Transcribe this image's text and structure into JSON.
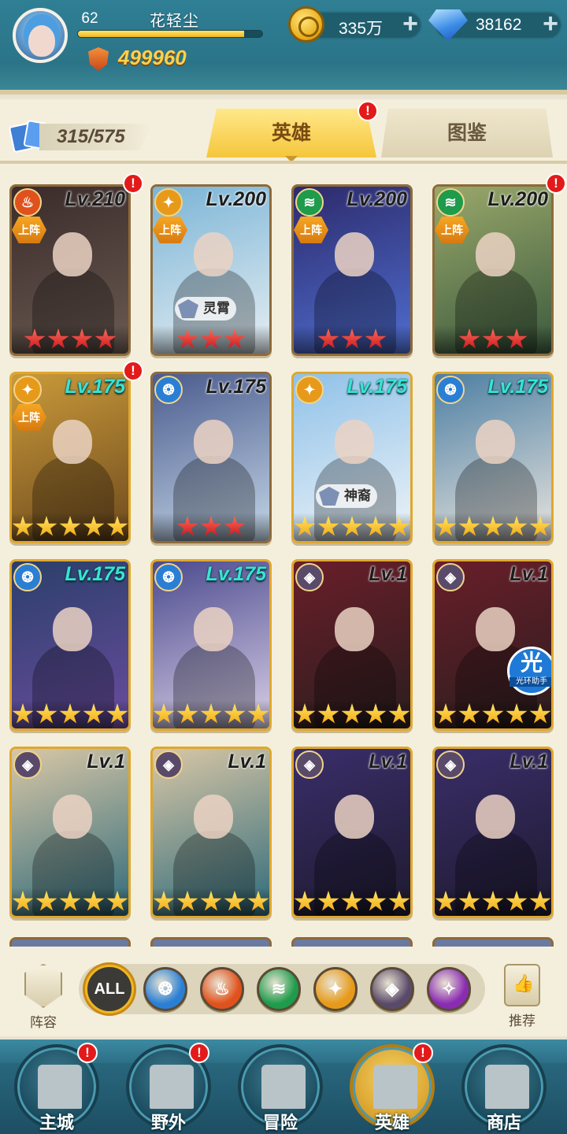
{
  "player": {
    "level": "62",
    "name": "花轻尘",
    "xp_fraction": 0.9,
    "power": "499960"
  },
  "resources": {
    "gold": "335万",
    "gems": "38162"
  },
  "collection": {
    "count": "315/575"
  },
  "tabs": {
    "heroes": "英雄",
    "codex": "图鉴"
  },
  "alert_mark": "!",
  "heroes": [
    {
      "level": "Lv.210",
      "level_style": "dark",
      "faction": "fire",
      "faction_color": "#e0521d",
      "deployed": true,
      "deployed_label": "上阵",
      "stars": 4,
      "star_color": "red",
      "alert": true,
      "bg": [
        "#3a2b2a",
        "#6a5a52"
      ],
      "tag": "",
      "aura": false
    },
    {
      "level": "Lv.200",
      "level_style": "dark",
      "faction": "light",
      "faction_color": "#e79a19",
      "deployed": true,
      "deployed_label": "上阵",
      "stars": 3,
      "star_color": "red",
      "alert": false,
      "bg": [
        "#7ab4d6",
        "#e6eef2"
      ],
      "tag": "灵霄",
      "aura": false
    },
    {
      "level": "Lv.200",
      "level_style": "dark",
      "faction": "nature",
      "faction_color": "#1e9b4b",
      "deployed": true,
      "deployed_label": "上阵",
      "stars": 3,
      "star_color": "red",
      "alert": false,
      "bg": [
        "#2d2a6b",
        "#4f6ed0"
      ],
      "tag": "",
      "aura": false
    },
    {
      "level": "Lv.200",
      "level_style": "dark",
      "faction": "nature",
      "faction_color": "#1e9b4b",
      "deployed": true,
      "deployed_label": "上阵",
      "stars": 3,
      "star_color": "red",
      "alert": true,
      "bg": [
        "#9aa86a",
        "#3b5a3e"
      ],
      "tag": "",
      "aura": false
    },
    {
      "level": "Lv.175",
      "level_style": "cyan",
      "faction": "light",
      "faction_color": "#e79a19",
      "deployed": true,
      "deployed_label": "上阵",
      "stars": 5,
      "star_color": "yellow",
      "alert": true,
      "bg": [
        "#c99a3a",
        "#6e4a1e"
      ],
      "tag": "",
      "aura": false
    },
    {
      "level": "Lv.175",
      "level_style": "dark",
      "faction": "water",
      "faction_color": "#2a7fd4",
      "deployed": false,
      "deployed_label": "",
      "stars": 3,
      "star_color": "red",
      "alert": false,
      "bg": [
        "#4a5b8e",
        "#c4d6e6"
      ],
      "tag": "",
      "aura": false
    },
    {
      "level": "Lv.175",
      "level_style": "cyan",
      "faction": "light",
      "faction_color": "#e79a19",
      "deployed": false,
      "deployed_label": "",
      "stars": 5,
      "star_color": "yellow",
      "alert": false,
      "bg": [
        "#8fc1e8",
        "#eef4f8"
      ],
      "tag": "神裔",
      "aura": false
    },
    {
      "level": "Lv.175",
      "level_style": "cyan",
      "faction": "water",
      "faction_color": "#2a7fd4",
      "deployed": false,
      "deployed_label": "",
      "stars": 5,
      "star_color": "yellow",
      "alert": false,
      "bg": [
        "#4d7fa3",
        "#e8e4de"
      ],
      "tag": "",
      "aura": false
    },
    {
      "level": "Lv.175",
      "level_style": "cyan",
      "faction": "water",
      "faction_color": "#2a7fd4",
      "deployed": false,
      "deployed_label": "",
      "stars": 5,
      "star_color": "yellow",
      "alert": false,
      "bg": [
        "#2a3f6a",
        "#6a4c9e"
      ],
      "tag": "",
      "aura": false
    },
    {
      "level": "Lv.175",
      "level_style": "cyan",
      "faction": "water",
      "faction_color": "#2a7fd4",
      "deployed": false,
      "deployed_label": "",
      "stars": 5,
      "star_color": "yellow",
      "alert": false,
      "bg": [
        "#4b4a8e",
        "#d8cfe6"
      ],
      "tag": "",
      "aura": false
    },
    {
      "level": "Lv.1",
      "level_style": "dark",
      "faction": "dark",
      "faction_color": "#5a4a6a",
      "deployed": false,
      "deployed_label": "",
      "stars": 5,
      "star_color": "yellow",
      "alert": false,
      "bg": [
        "#6a1e2a",
        "#2a1e1e"
      ],
      "tag": "",
      "aura": false
    },
    {
      "level": "Lv.1",
      "level_style": "dark",
      "faction": "dark",
      "faction_color": "#5a4a6a",
      "deployed": false,
      "deployed_label": "",
      "stars": 5,
      "star_color": "yellow",
      "alert": false,
      "bg": [
        "#6a1e2a",
        "#2a1e1e"
      ],
      "tag": "",
      "aura": true,
      "aura_main": "光",
      "aura_sub": "光环助手"
    },
    {
      "level": "Lv.1",
      "level_style": "dark",
      "faction": "dark",
      "faction_color": "#5a4a6a",
      "deployed": false,
      "deployed_label": "",
      "stars": 5,
      "star_color": "yellow",
      "alert": false,
      "bg": [
        "#d9c7a6",
        "#2e6a7a"
      ],
      "tag": "",
      "aura": false
    },
    {
      "level": "Lv.1",
      "level_style": "dark",
      "faction": "dark",
      "faction_color": "#5a4a6a",
      "deployed": false,
      "deployed_label": "",
      "stars": 5,
      "star_color": "yellow",
      "alert": false,
      "bg": [
        "#d9c7a6",
        "#2e6a7a"
      ],
      "tag": "",
      "aura": false
    },
    {
      "level": "Lv.1",
      "level_style": "dark",
      "faction": "dark",
      "faction_color": "#5a4a6a",
      "deployed": false,
      "deployed_label": "",
      "stars": 5,
      "star_color": "yellow",
      "alert": false,
      "bg": [
        "#3a2e6a",
        "#1e1a2e"
      ],
      "tag": "",
      "aura": false
    },
    {
      "level": "Lv.1",
      "level_style": "dark",
      "faction": "dark",
      "faction_color": "#5a4a6a",
      "deployed": false,
      "deployed_label": "",
      "stars": 5,
      "star_color": "yellow",
      "alert": false,
      "bg": [
        "#3a2e6a",
        "#1e1a2e"
      ],
      "tag": "",
      "aura": false
    }
  ],
  "filter": {
    "lineup_label": "阵容",
    "recommend_label": "推荐",
    "all_label": "ALL",
    "factions": [
      {
        "name": "water",
        "color": "#2a7fd4"
      },
      {
        "name": "fire",
        "color": "#e0521d"
      },
      {
        "name": "nature",
        "color": "#1e9b4b"
      },
      {
        "name": "light",
        "color": "#e79a19"
      },
      {
        "name": "dark",
        "color": "#5a4a6a"
      },
      {
        "name": "arcane",
        "color": "#8a2cb2"
      }
    ]
  },
  "nav": [
    {
      "label": "主城",
      "alert": true,
      "active": false
    },
    {
      "label": "野外",
      "alert": true,
      "active": false
    },
    {
      "label": "冒险",
      "alert": false,
      "active": false
    },
    {
      "label": "英雄",
      "alert": true,
      "active": true
    },
    {
      "label": "商店",
      "alert": false,
      "active": false
    }
  ]
}
